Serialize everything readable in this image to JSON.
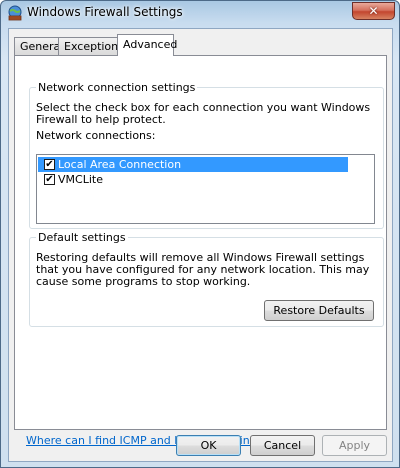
{
  "window": {
    "title": "Windows Firewall Settings",
    "close_glyph": "✕"
  },
  "tabs": [
    {
      "label": "General",
      "active": false
    },
    {
      "label": "Exceptions",
      "active": false
    },
    {
      "label": "Advanced",
      "active": true
    }
  ],
  "network_group": {
    "legend": "Network connection settings",
    "description": "Select the check box for each connection you want Windows Firewall to help protect.",
    "list_label": "Network connections:",
    "connections": [
      {
        "label": "Local Area Connection",
        "checked": true,
        "selected": true
      },
      {
        "label": "VMCLite",
        "checked": true,
        "selected": false
      }
    ]
  },
  "defaults_group": {
    "legend": "Default settings",
    "description": "Restoring defaults will remove all Windows Firewall settings that you have configured for any network location. This may cause some programs to stop working.",
    "restore_button": "Restore Defaults"
  },
  "help_link": "Where can I find ICMP and logging settings?",
  "buttons": {
    "ok": "OK",
    "cancel": "Cancel",
    "apply": "Apply"
  },
  "icons": {
    "app": "firewall-globe-icon",
    "check": "✔"
  },
  "colors": {
    "selection": "#3399ff",
    "link": "#0066cc",
    "close": "#c3462f"
  }
}
